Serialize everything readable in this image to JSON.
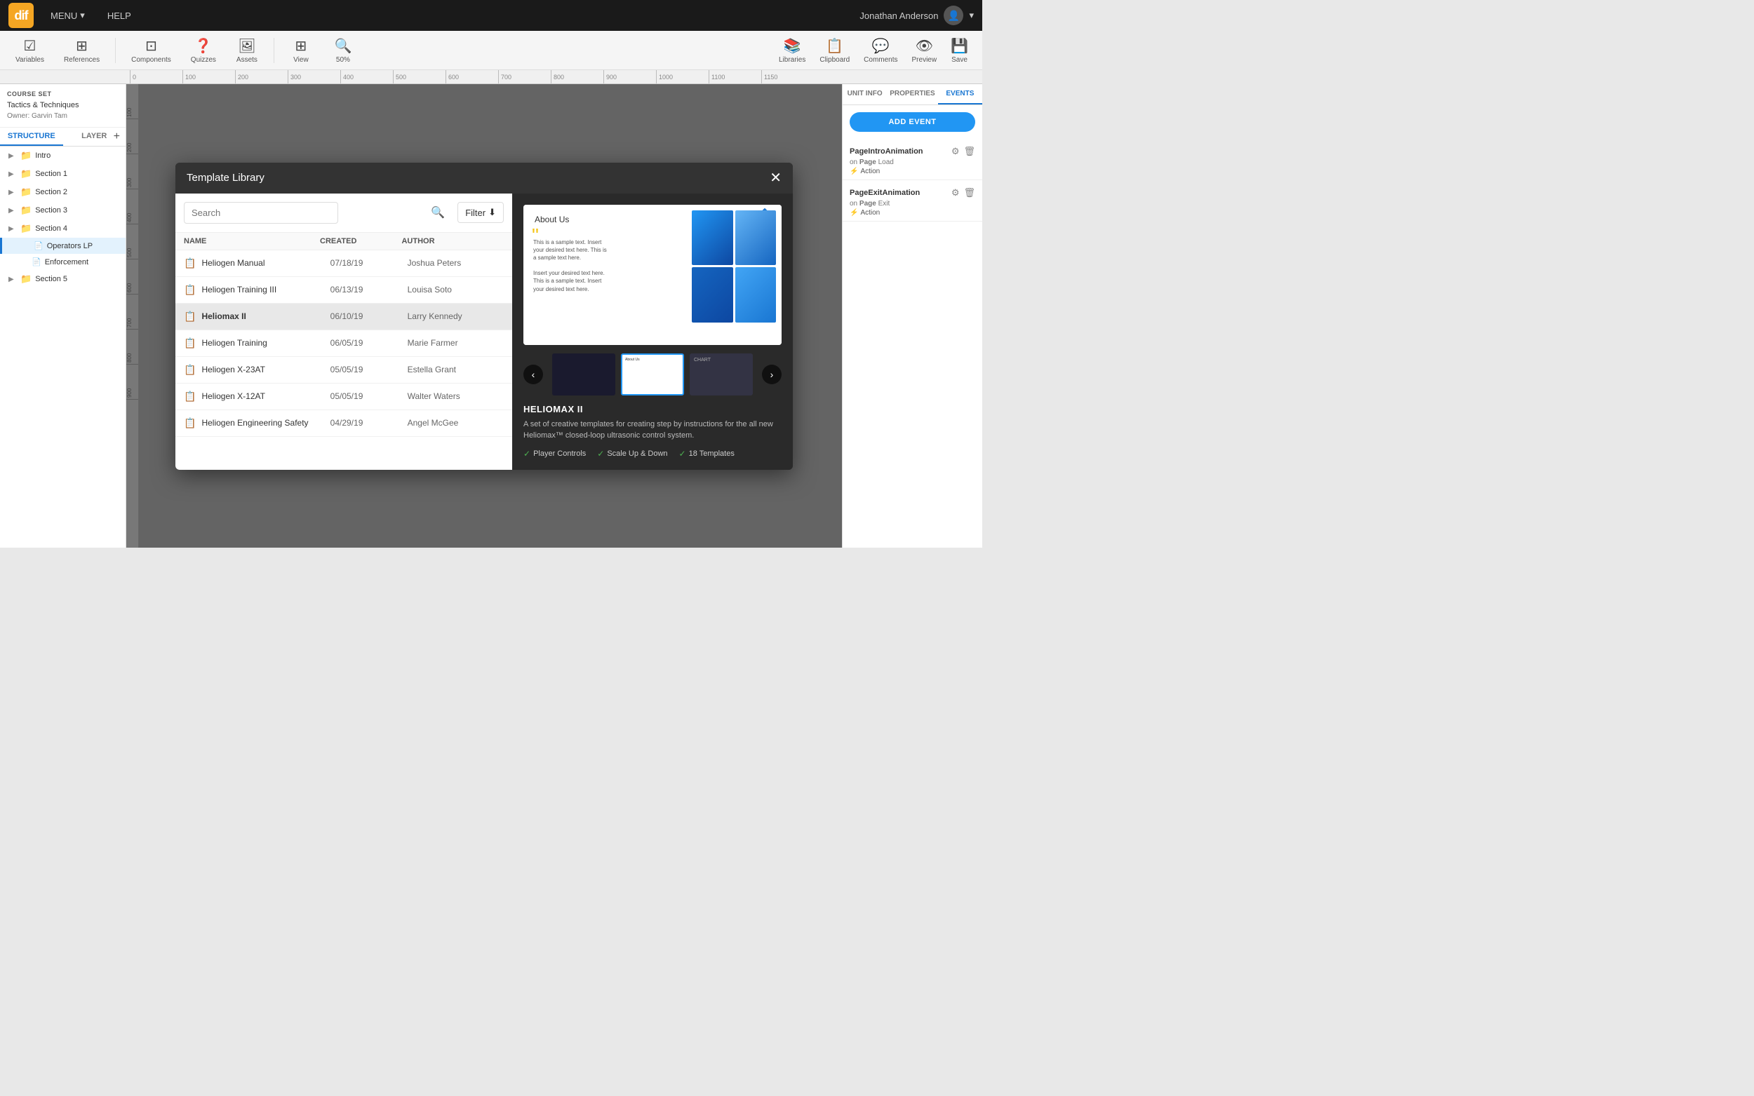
{
  "app": {
    "logo": "dif",
    "menu_label": "MENU",
    "help_label": "HELP",
    "user_name": "Jonathan Anderson",
    "user_chevron": "▾"
  },
  "toolbar": {
    "variables_label": "Variables",
    "references_label": "References",
    "components_label": "Components",
    "quizzes_label": "Quizzes",
    "assets_label": "Assets",
    "view_label": "View",
    "zoom_label": "50%",
    "libraries_label": "Libraries",
    "clipboard_label": "Clipboard",
    "comments_label": "Comments",
    "preview_label": "Preview",
    "save_label": "Save"
  },
  "ruler": {
    "marks": [
      "0",
      "100",
      "200",
      "300",
      "400",
      "500",
      "600",
      "700",
      "800",
      "900",
      "1000",
      "1100",
      "1150"
    ]
  },
  "sidebar": {
    "course_set_label": "COURSE SET",
    "course_name": "Tactics & Techniques",
    "owner_label": "Owner: Garvin Tam",
    "tab_structure": "STRUCTURE",
    "tab_layer": "LAYER",
    "items": [
      {
        "id": "intro",
        "label": "Intro",
        "type": "folder",
        "level": 0
      },
      {
        "id": "section1",
        "label": "Section 1",
        "type": "folder",
        "level": 0
      },
      {
        "id": "section2",
        "label": "Section 2",
        "type": "folder",
        "level": 0
      },
      {
        "id": "section3",
        "label": "Section 3",
        "type": "folder",
        "level": 0
      },
      {
        "id": "section4",
        "label": "Section 4",
        "type": "folder",
        "level": 0
      },
      {
        "id": "operators-lp",
        "label": "Operators LP",
        "type": "page",
        "level": 1,
        "active": true
      },
      {
        "id": "enforcement",
        "label": "Enforcement",
        "type": "page",
        "level": 1
      },
      {
        "id": "section5",
        "label": "Section 5",
        "type": "folder",
        "level": 0
      }
    ]
  },
  "right_panel": {
    "tab_unit_info": "UNIT INFO",
    "tab_properties": "PROPERTIES",
    "tab_events": "EVENTS",
    "add_event_btn": "ADD EVENT",
    "events": [
      {
        "id": "page-intro-animation",
        "title": "PageIntroAnimation",
        "trigger": "on Page Load",
        "action_icon": "⚡",
        "action": "Action"
      },
      {
        "id": "page-exit-animation",
        "title": "PageExitAnimation",
        "trigger": "on Page Exit",
        "action_icon": "⚡",
        "action": "Action"
      }
    ]
  },
  "modal": {
    "title": "Template Library",
    "search_placeholder": "Search",
    "filter_label": "Filter",
    "columns": {
      "name": "NAME",
      "created": "CREATED",
      "author": "AUTHOR"
    },
    "rows": [
      {
        "id": 1,
        "name": "Heliogen Manual",
        "created": "07/18/19",
        "author": "Joshua Peters"
      },
      {
        "id": 2,
        "name": "Heliogen Training III",
        "created": "06/13/19",
        "author": "Louisa Soto"
      },
      {
        "id": 3,
        "name": "Heliomax II",
        "created": "06/10/19",
        "author": "Larry Kennedy",
        "selected": true
      },
      {
        "id": 4,
        "name": "Heliogen Training",
        "created": "06/05/19",
        "author": "Marie Farmer"
      },
      {
        "id": 5,
        "name": "Heliogen X-23AT",
        "created": "05/05/19",
        "author": "Estella Grant"
      },
      {
        "id": 6,
        "name": "Heliogen X-12AT",
        "created": "05/05/19",
        "author": "Walter Waters"
      },
      {
        "id": 7,
        "name": "Heliogen Engineering Safety",
        "created": "04/29/19",
        "author": "Angel McGee"
      }
    ],
    "preview": {
      "about_us": "About Us",
      "quote_char": "“",
      "sample_text1": "This is a sample text. Insert your desired text here. This is a sample text here.",
      "sample_text2": "Insert your desired text here. This is a sample text. Insert your desired text here.",
      "template_name": "HELIOMAX II",
      "description": "A set of creative templates for creating step by instructions for the all new Heliomax™ closed-loop ultrasonic control system.",
      "features": [
        "Player Controls",
        "Scale Up & Down",
        "18 Templates"
      ]
    }
  }
}
